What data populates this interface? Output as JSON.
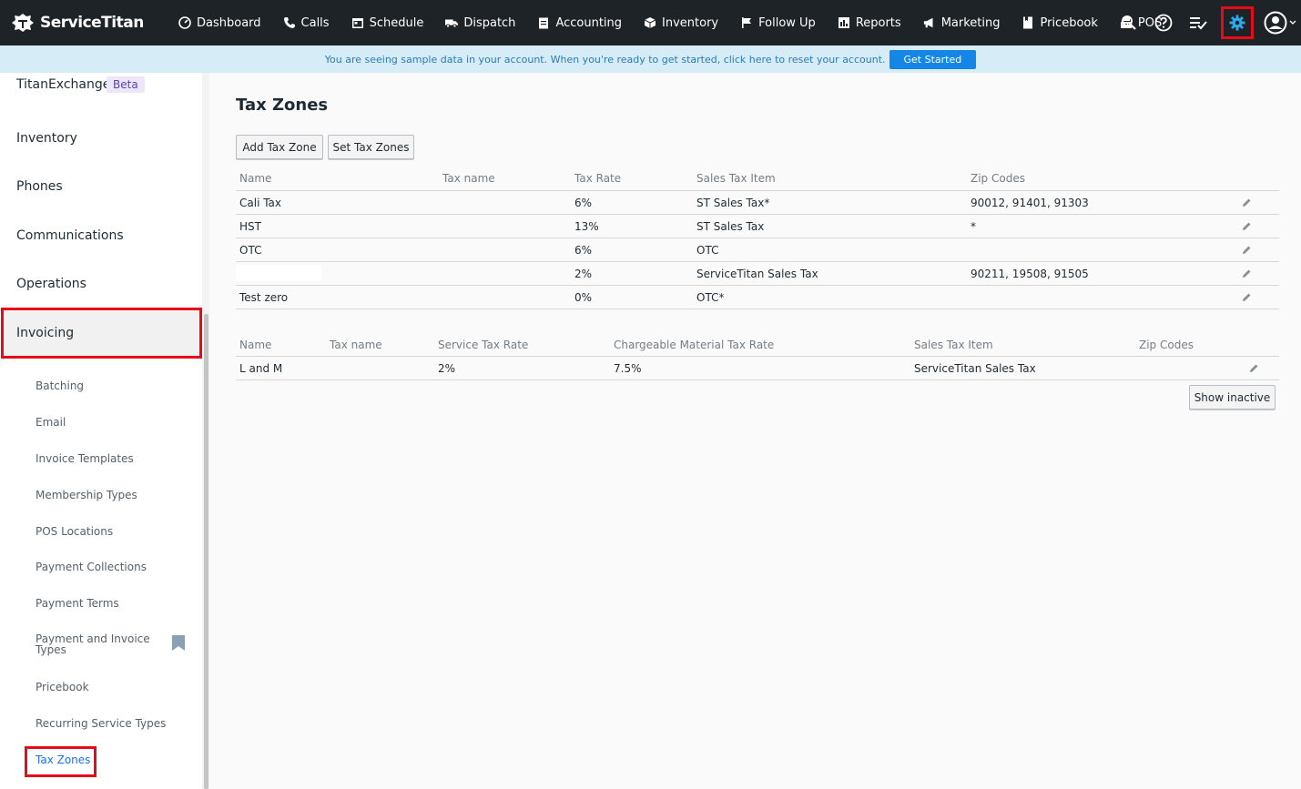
{
  "brand": {
    "name": "ServiceTitan"
  },
  "nav": {
    "items": [
      {
        "label": "Dashboard",
        "icon": "dashboard-icon"
      },
      {
        "label": "Calls",
        "icon": "phone-icon"
      },
      {
        "label": "Schedule",
        "icon": "calendar-icon"
      },
      {
        "label": "Dispatch",
        "icon": "truck-icon"
      },
      {
        "label": "Accounting",
        "icon": "clipboard-icon"
      },
      {
        "label": "Inventory",
        "icon": "box-icon"
      },
      {
        "label": "Follow Up",
        "icon": "flag-icon"
      },
      {
        "label": "Reports",
        "icon": "chart-icon"
      },
      {
        "label": "Marketing",
        "icon": "megaphone-icon"
      },
      {
        "label": "Pricebook",
        "icon": "book-icon"
      },
      {
        "label": "POS",
        "icon": "register-icon"
      }
    ],
    "right_icons": [
      "search-icon",
      "help-icon",
      "tasks-icon",
      "gear-icon",
      "user-avatar-icon"
    ],
    "accent": "#2fa8f0"
  },
  "banner": {
    "text": "You are seeing sample data in your account. When you're ready to get started, click here to reset your account.",
    "button": "Get Started"
  },
  "sidebar": {
    "items": [
      {
        "label": "TitanExchange",
        "badge": "Beta"
      },
      {
        "label": "Inventory"
      },
      {
        "label": "Phones"
      },
      {
        "label": "Communications"
      },
      {
        "label": "Operations"
      },
      {
        "label": "Invoicing"
      }
    ],
    "subitems": [
      "Batching",
      "Email",
      "Invoice Templates",
      "Membership Types",
      "POS Locations",
      "Payment Collections",
      "Payment Terms",
      "Payment and Invoice Types",
      "Pricebook",
      "Recurring Service Types",
      "Tax Zones"
    ]
  },
  "main": {
    "title": "Tax Zones",
    "buttons": {
      "add": "Add Tax Zone",
      "set": "Set Tax Zones",
      "show_inactive": "Show inactive"
    },
    "table1": {
      "headers": [
        "Name",
        "Tax name",
        "Tax Rate",
        "Sales Tax Item",
        "Zip Codes"
      ],
      "rows": [
        [
          "Cali Tax",
          "",
          "6%",
          "ST Sales Tax*",
          "90012, 91401, 91303"
        ],
        [
          "HST",
          "",
          "13%",
          "ST Sales Tax",
          "*"
        ],
        [
          "OTC",
          "",
          "6%",
          "OTC",
          ""
        ],
        [
          "",
          "",
          "2%",
          "ServiceTitan Sales Tax",
          "90211, 19508, 91505"
        ],
        [
          "Test zero",
          "",
          "0%",
          "OTC*",
          ""
        ]
      ]
    },
    "table2": {
      "headers": [
        "Name",
        "Tax name",
        "Service Tax Rate",
        "Chargeable Material Tax Rate",
        "Sales Tax Item",
        "Zip Codes"
      ],
      "rows": [
        [
          "L and M",
          "",
          "2%",
          "7.5%",
          "ServiceTitan Sales Tax",
          ""
        ]
      ]
    }
  }
}
